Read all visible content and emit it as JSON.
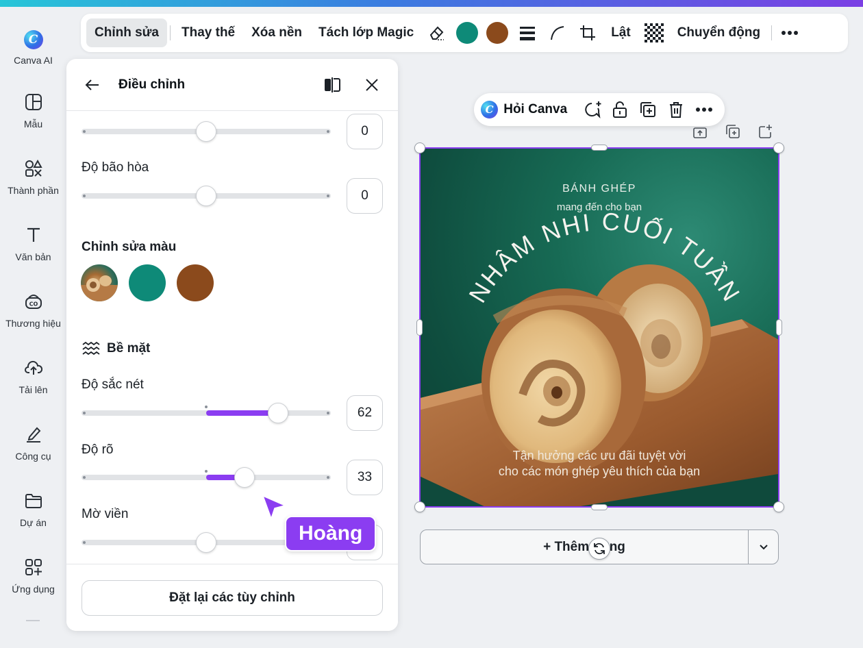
{
  "rail": {
    "items": [
      {
        "label": "Canva AI"
      },
      {
        "label": "Mẫu"
      },
      {
        "label": "Thành phần"
      },
      {
        "label": "Văn bản"
      },
      {
        "label": "Thương hiệu"
      },
      {
        "label": "Tải lên"
      },
      {
        "label": "Công cụ"
      },
      {
        "label": "Dự án"
      },
      {
        "label": "Ứng dụng"
      }
    ]
  },
  "toolbar": {
    "edit": "Chỉnh sửa",
    "replace": "Thay thế",
    "remove_bg": "Xóa nền",
    "magic_layers": "Tách lớp Magic",
    "flip": "Lật",
    "animate": "Chuyển động",
    "color1": "#0e8a78",
    "color2": "#8b4a1c"
  },
  "panel": {
    "title": "Điều chỉnh",
    "top_slider_value": "0",
    "saturation_label": "Độ bão hòa",
    "saturation_value": "0",
    "edit_colors_title": "Chỉnh sửa màu",
    "swatch_teal": "#0e8a78",
    "swatch_brown": "#8b4a1c",
    "texture_title": "Bề mặt",
    "sharpness_label": "Độ sắc nét",
    "sharpness_value": "62",
    "clarity_label": "Độ rõ",
    "clarity_value": "33",
    "vignette_label": "Mờ viền",
    "reset_label": "Đặt lại các tùy chỉnh"
  },
  "collaborator": {
    "name": "Hoàng",
    "color": "#8b3df1"
  },
  "ask_canva": {
    "label": "Hỏi Canva"
  },
  "artwork": {
    "heading": "BÁNH GHÉP",
    "subheading": "mang đến cho bạn",
    "arc_text": "NHÂM NHI CUỐI TUẦN",
    "caption_line1": "Tận hưởng các ưu đãi tuyệt vời",
    "caption_line2": "cho các món ghép yêu thích của bạn"
  },
  "add_page": {
    "label": "+ Thêm trang"
  }
}
